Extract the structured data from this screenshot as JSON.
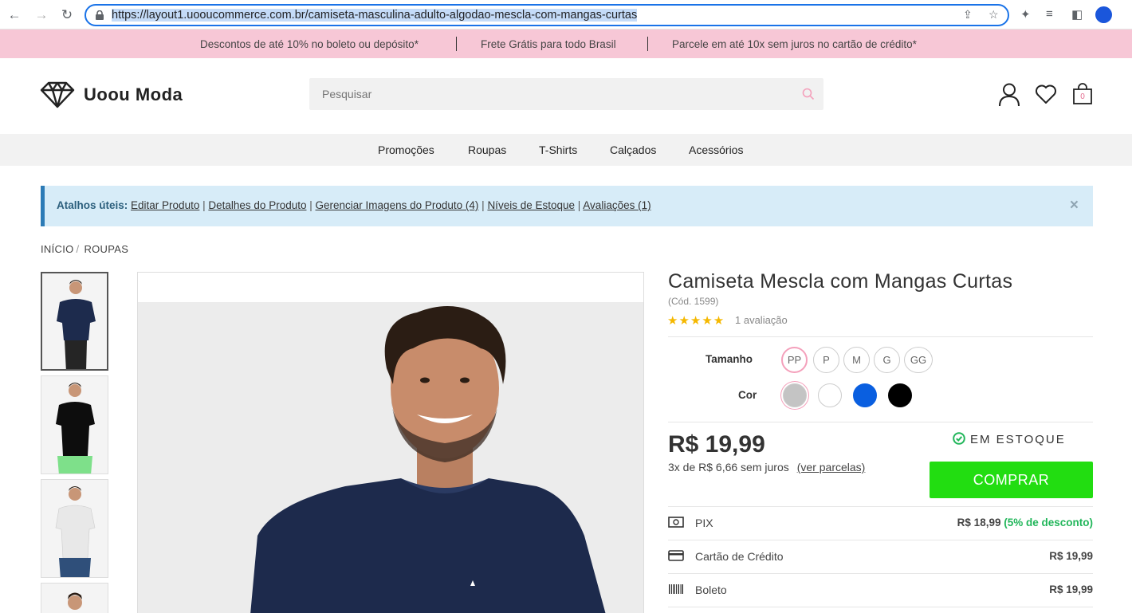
{
  "browser": {
    "url": "https://layout1.uooucommerce.com.br/camiseta-masculina-adulto-algodao-mescla-com-mangas-curtas"
  },
  "promo": {
    "items": [
      "Descontos de até 10% no boleto ou depósito*",
      "Frete Grátis para todo Brasil",
      "Parcele em até 10x sem juros no cartão de crédito*"
    ]
  },
  "header": {
    "logo_text": "Uoou Moda",
    "search_placeholder": "Pesquisar",
    "cart_count": "0"
  },
  "menu": {
    "items": [
      "Promoções",
      "Roupas",
      "T-Shirts",
      "Calçados",
      "Acessórios"
    ]
  },
  "alert": {
    "label": "Atalhos úteis:",
    "links": [
      "Editar Produto",
      "Detalhes do Produto",
      "Gerenciar Imagens do Produto (4)",
      "Níveis de Estoque",
      "Avaliações (1)"
    ],
    "separator": "|",
    "close": "×"
  },
  "breadcrumb": {
    "items": [
      "INÍCIO",
      "ROUPAS"
    ],
    "separator": "/"
  },
  "product": {
    "title": "Camiseta Mescla com Mangas Curtas",
    "code": "(Cód. 1599)",
    "rating_stars": "★★★★★",
    "rating": 5,
    "reviews": "1 avaliação",
    "size_label": "Tamanho",
    "sizes": [
      "PP",
      "P",
      "M",
      "G",
      "GG"
    ],
    "selected_size": "PP",
    "color_label": "Cor",
    "colors": [
      "#c4c4c4",
      "#ffffff",
      "#0a5fe0",
      "#000000"
    ],
    "price": "R$ 19,99",
    "installments": "3x de R$ 6,66 sem juros",
    "installments_link": "(ver parcelas)",
    "stock": "EM ESTOQUE",
    "buy_label": "COMPRAR"
  },
  "payments": [
    {
      "name": "PIX",
      "value": "R$ 18,99",
      "discount": "(5% de desconto)",
      "icon": "cash-icon"
    },
    {
      "name": "Cartão de Crédito",
      "value": "R$ 19,99",
      "icon": "credit-card-icon"
    },
    {
      "name": "Boleto",
      "value": "R$ 19,99",
      "icon": "barcode-icon"
    }
  ],
  "colors": {
    "promo_bg": "#f7c7d6",
    "buy_button": "#22dd11",
    "alert_bg": "#d7ecf8",
    "star": "#f5b800",
    "discount": "#21b65a"
  }
}
